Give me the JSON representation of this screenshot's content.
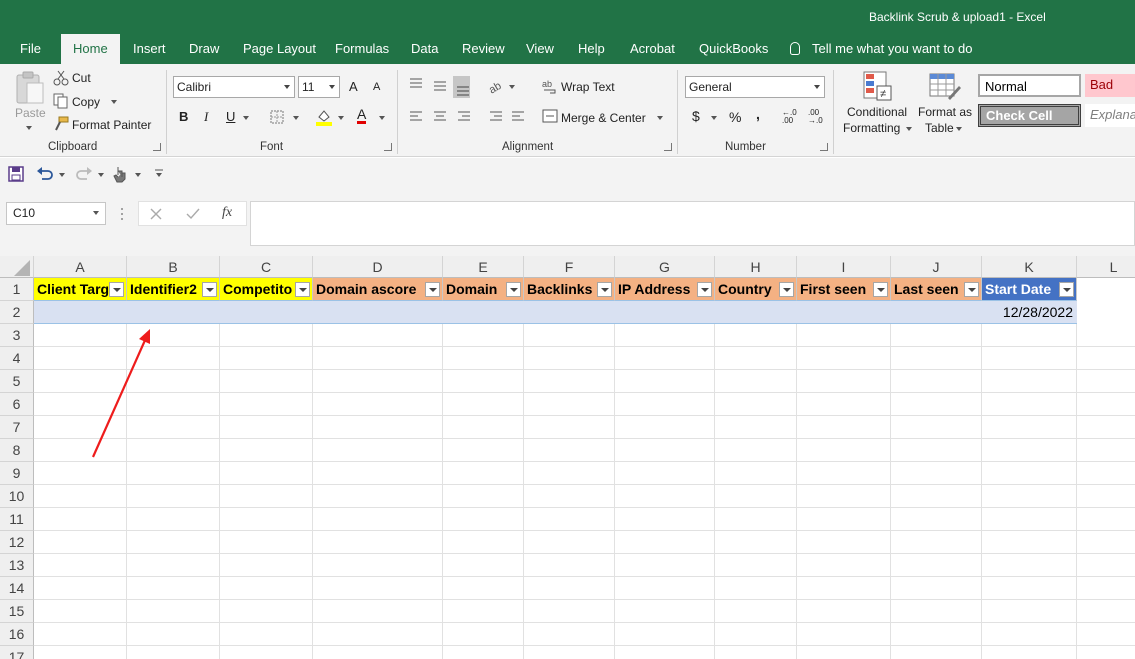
{
  "window": {
    "title": "Backlink Scrub & upload1  -  Excel"
  },
  "tabs": [
    {
      "label": "File"
    },
    {
      "label": "Home"
    },
    {
      "label": "Insert"
    },
    {
      "label": "Draw"
    },
    {
      "label": "Page Layout"
    },
    {
      "label": "Formulas"
    },
    {
      "label": "Data"
    },
    {
      "label": "Review"
    },
    {
      "label": "View"
    },
    {
      "label": "Help"
    },
    {
      "label": "Acrobat"
    },
    {
      "label": "QuickBooks"
    }
  ],
  "active_tab": "Home",
  "tell_me": "Tell me what you want to do",
  "clipboard": {
    "paste": "Paste",
    "cut": "Cut",
    "copy": "Copy",
    "format_painter": "Format Painter",
    "label": "Clipboard"
  },
  "font": {
    "name": "Calibri",
    "size": "11",
    "bold": "B",
    "italic": "I",
    "underline": "U",
    "label": "Font",
    "grow": "A",
    "shrink": "A",
    "color_letter": "A"
  },
  "alignment": {
    "wrap_text": "Wrap Text",
    "merge_center": "Merge & Center",
    "label": "Alignment"
  },
  "number": {
    "format": "General",
    "currency": "$",
    "percent": "%",
    "comma": ",",
    "inc_dec": "←.0 .00",
    "dec_dec": ".00 →.0",
    "label": "Number"
  },
  "styles": {
    "conditional_formatting": [
      "Conditional",
      "Formatting"
    ],
    "format_as_table": [
      "Format as",
      "Table"
    ],
    "normal": "Normal",
    "bad": "Bad",
    "check_cell": "Check Cell",
    "explanatory": "Explanat"
  },
  "formula_bar": {
    "name_box": "C10",
    "fx": "fx",
    "content": ""
  },
  "columns": [
    "A",
    "B",
    "C",
    "D",
    "E",
    "F",
    "G",
    "H",
    "I",
    "J",
    "K",
    "L"
  ],
  "rows": [
    "1",
    "2",
    "3",
    "4",
    "5",
    "6",
    "7",
    "8",
    "9",
    "10",
    "11",
    "12",
    "13",
    "14",
    "15",
    "16",
    "17"
  ],
  "headers": [
    {
      "text": "Client Targ",
      "color": "#ffff00"
    },
    {
      "text": "Identifier2",
      "color": "#ffff00"
    },
    {
      "text": "Competito",
      "color": "#ffff00"
    },
    {
      "text": "Domain ascore",
      "color": "#f4b183"
    },
    {
      "text": "Domain",
      "color": "#f4b183"
    },
    {
      "text": "Backlinks",
      "color": "#f4b183"
    },
    {
      "text": "IP Address",
      "color": "#f4b183"
    },
    {
      "text": "Country",
      "color": "#f4b183"
    },
    {
      "text": "First seen",
      "color": "#f4b183"
    },
    {
      "text": "Last seen",
      "color": "#f4b183"
    },
    {
      "text": "Start Date",
      "color": "#4472c4"
    }
  ],
  "row2": {
    "start_date": "12/28/2022"
  },
  "annotation": {
    "color": "#ff0000"
  }
}
